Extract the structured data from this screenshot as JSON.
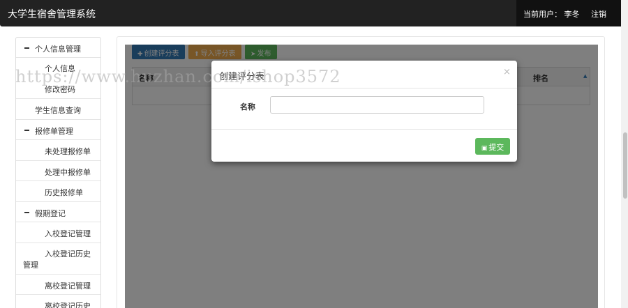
{
  "header": {
    "title": "大学生宿舍管理系统",
    "current_user": "当前用户：  李冬",
    "logout": "注销"
  },
  "sidebar": {
    "items": [
      {
        "label": "个人信息管理"
      },
      {
        "label": "个人信息"
      },
      {
        "label": "修改密码"
      },
      {
        "label": "学生信息查询"
      },
      {
        "label": "报修单管理"
      },
      {
        "label": "未处理报修单"
      },
      {
        "label": "处理中报修单"
      },
      {
        "label": "历史报修单"
      },
      {
        "label": "假期登记"
      },
      {
        "label": "入校登记管理"
      },
      {
        "label": "入校登记历史",
        "label2": "管理"
      },
      {
        "label": "离校登记管理"
      },
      {
        "label": "离校登记历史"
      }
    ]
  },
  "toolbar": {
    "create_label": "创建评分表",
    "import_label": "导入评分表",
    "publish_label": "发布"
  },
  "table": {
    "columns": [
      "名称",
      "排名"
    ]
  },
  "modal": {
    "title": "创建评分表",
    "close": "×",
    "field_label": "名称",
    "field_value": "",
    "submit_label": "提交"
  },
  "watermark": "https://www.huzhan.com/ishop3572"
}
